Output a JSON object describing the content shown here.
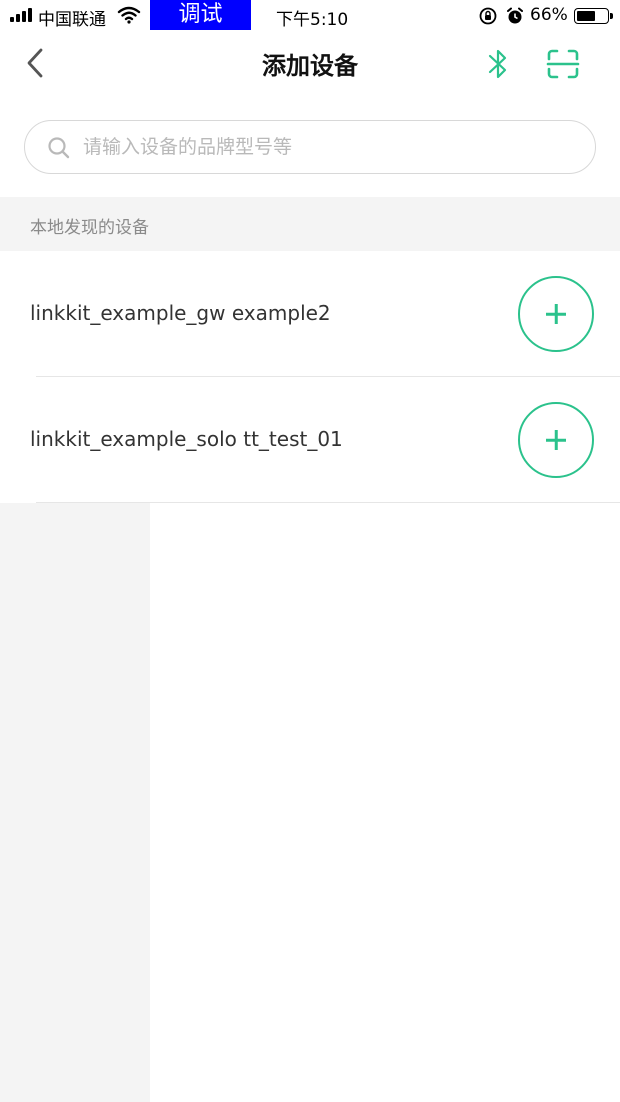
{
  "status_bar": {
    "carrier": "中国联通",
    "debug_label": "调试",
    "time": "下午5:10",
    "battery_percent": "66%",
    "battery_level": 0.66
  },
  "nav": {
    "title": "添加设备",
    "accent_color": "#2bc28c"
  },
  "search": {
    "placeholder": "请输入设备的品牌型号等",
    "value": ""
  },
  "section": {
    "header": "本地发现的设备"
  },
  "devices": [
    {
      "name": "linkkit_example_gw example2"
    },
    {
      "name": "linkkit_example_solo tt_test_01"
    }
  ],
  "icons": {
    "back": "chevron-left-icon",
    "bluetooth": "bluetooth-icon",
    "scan": "scan-icon",
    "search": "search-icon",
    "add": "plus-icon"
  }
}
